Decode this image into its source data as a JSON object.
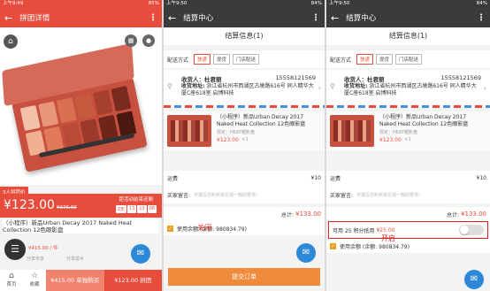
{
  "panel1": {
    "status": {
      "time": "上午9:49",
      "battery": "85%"
    },
    "title": "拼团详情",
    "members_tag": "3人拼团价",
    "price": "¥123.00",
    "orig_price": "¥376.00",
    "countdown_label": "距活动结束还剩",
    "countdown": [
      "2天",
      "13",
      "13",
      "08"
    ],
    "product_title": "（小程序）新品Urban Decay 2017 Naked Heat Collection 12色眼影盘",
    "sub_price": "¥415.00 / 件",
    "share_items": [
      "分享专享",
      "分享返木"
    ],
    "nav": [
      {
        "icon": "home-icon",
        "label": "首页"
      },
      {
        "icon": "star-icon",
        "label": "收藏"
      }
    ],
    "buy_single": "¥415.00 单独购买",
    "buy_group": "¥123.00 拼团",
    "colors": {
      "accent": "#e74c3c"
    }
  },
  "panel2": {
    "status": {
      "time": "上午9:50",
      "battery": "84%"
    },
    "title": "结算中心",
    "section": "结算信息(1)",
    "ship_label": "配送方式",
    "ship_options": [
      "快递",
      "提货",
      "门店配送"
    ],
    "receiver_label": "收货人：杜君丽",
    "receiver_phone": "15558121569",
    "address_label": "收货地址:",
    "address": "浙江省杭州市西湖区古墩路616号 同人精华大厦C座618室 启博科技",
    "item_name": "（小程序）新品Urban Decay 2017 Naked Heat Collection 12色眼影盘",
    "item_spec": "规定：HEAT眼影盘",
    "item_price": "¥123.00",
    "item_qty": "×1",
    "freight_label": "运费",
    "freight_value": "¥10",
    "note_label": "买家留言:",
    "note_placeholder": "可填写您和卖家达成一致的要求!",
    "total_label": "总计:",
    "total_value": "¥133.00",
    "annotation": "关闭",
    "balance": "使用余额 (余额: 980834.79)",
    "submit": "提交订单"
  },
  "panel3": {
    "status": {
      "time": "上午9:50",
      "battery": "84%"
    },
    "title": "结算中心",
    "annotation": "开启",
    "points_prefix": "可用 25 积分抵用",
    "points_value": "¥25.00"
  }
}
